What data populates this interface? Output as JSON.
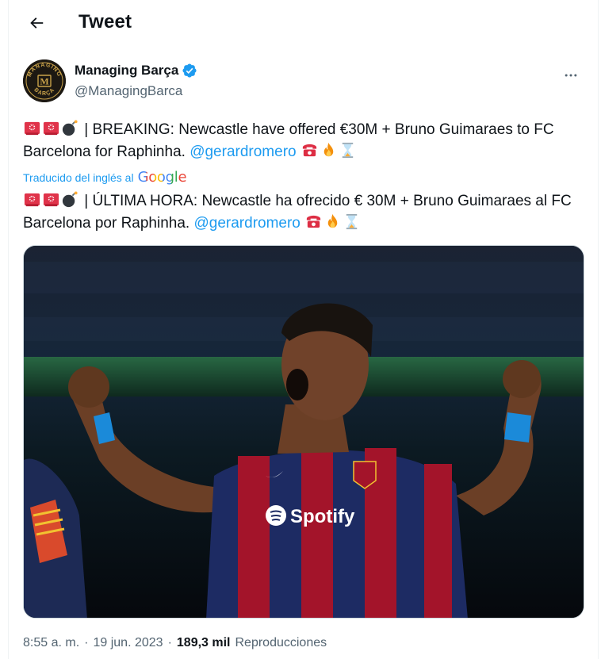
{
  "header": {
    "title": "Tweet"
  },
  "author": {
    "name": "Managing Barça",
    "handle": "@ManagingBarca",
    "avatar_text_top": "MANAGING",
    "avatar_text_bottom": "BARÇA",
    "avatar_monogram": "M"
  },
  "tweet": {
    "original_text": "| BREAKING: Newcastle have offered €30M + Bruno Guimaraes to FC Barcelona for Raphinha.",
    "mention": "@gerardromero",
    "translated_label": "Traducido del inglés al",
    "translator": "Google",
    "translated_text": "| ÚLTIMA HORA: Newcastle ha ofrecido € 30M + Bruno Guimaraes al FC Barcelona por Raphinha.",
    "image_alt": {
      "sponsor": "Spotify"
    }
  },
  "meta": {
    "time": "8:55 a. m.",
    "sep1": "·",
    "date": "19 jun. 2023",
    "sep2": "·",
    "views_count": "189,3 mil",
    "views_label": "Reproducciones"
  },
  "colors": {
    "accent": "#1d9bf0",
    "text": "#0f1419",
    "muted": "#536471",
    "border": "#cfd9de"
  },
  "icons": {
    "back": "arrow-left-icon",
    "verified": "verified-badge-icon",
    "more": "more-horizontal-icon",
    "emoji_1": "rotating-light-icon",
    "emoji_2": "bomb-icon",
    "emoji_3": "telephone-icon",
    "emoji_4": "fire-icon",
    "emoji_5": "hourglass-icon"
  }
}
